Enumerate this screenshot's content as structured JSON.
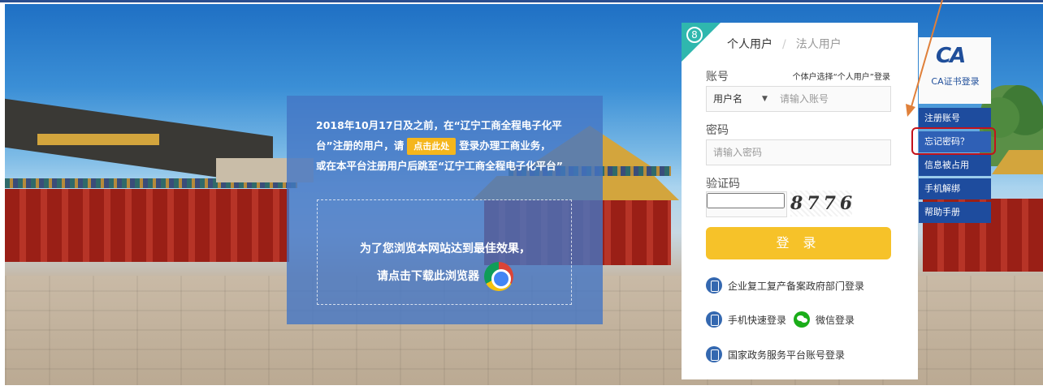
{
  "notice": {
    "line1": "2018年10月17日及之前，在“辽宁工商全程电子化平",
    "line2a": "台”注册的用户，请",
    "click_here": "点击此处",
    "line2b": "登录办理工商业务，",
    "line3": "或在本平台注册用户后跳至“辽宁工商全程电子化平台”",
    "browser_line1": "为了您浏览本网站达到最佳效果，",
    "browser_line2": "请点击下载此浏览器"
  },
  "login": {
    "tab_personal": "个人用户",
    "tab_sep": "/",
    "tab_corporate": "法人用户",
    "account_label": "账号",
    "account_hint": "个体户选择“个人用户”登录",
    "username_select": "用户名",
    "account_placeholder": "请输入账号",
    "password_label": "密码",
    "password_placeholder": "请输入密码",
    "captcha_label": "验证码",
    "captcha_code": "8776",
    "login_button": "登 录",
    "alt_gov_dept": "企业复工复产备案政府部门登录",
    "alt_mobile": "手机快速登录",
    "alt_wechat": "微信登录",
    "alt_national": "国家政务服务平台账号登录"
  },
  "side": {
    "ca_logo": "CA",
    "ca_label": "CA证书登录",
    "items": [
      "注册账号",
      "忘记密码？",
      "信息被占用",
      "手机解绑",
      "帮助手册"
    ]
  },
  "icons": {
    "corner": "user-circle-icon",
    "phone": "phone-icon",
    "wechat": "wechat-icon",
    "browser": "chrome-icon",
    "dropdown": "caret-down-icon"
  },
  "colors": {
    "primary_blue": "#1e4c9e",
    "accent_yellow": "#f6c229",
    "teal": "#2fb7ae",
    "highlight_red": "#c3121b",
    "arrow_orange": "#e0803a"
  }
}
